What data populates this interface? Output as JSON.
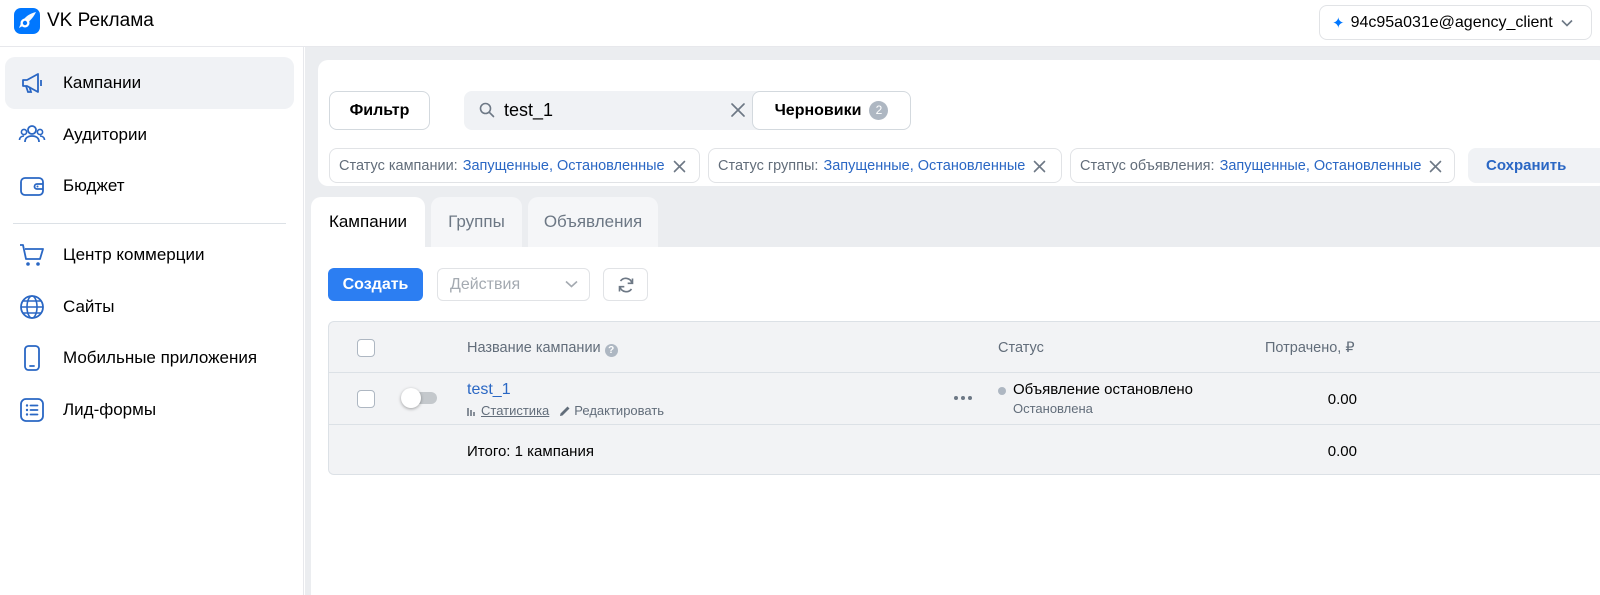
{
  "app": {
    "title": "VK Реклама",
    "account": "94c95a031e@agency_client",
    "brand_color": "#0077ff",
    "link_color": "#2a67c4"
  },
  "sidebar": {
    "items": [
      {
        "label": "Кампании",
        "icon": "megaphone-icon",
        "active": true
      },
      {
        "label": "Аудитории",
        "icon": "users-icon",
        "active": false
      },
      {
        "label": "Бюджет",
        "icon": "wallet-icon",
        "active": false
      },
      {
        "label": "Центр коммерции",
        "icon": "cart-icon",
        "active": false
      },
      {
        "label": "Сайты",
        "icon": "globe-icon",
        "active": false
      },
      {
        "label": "Мобильные приложения",
        "icon": "phone-icon",
        "active": false
      },
      {
        "label": "Лид-формы",
        "icon": "list-form-icon",
        "active": false
      }
    ]
  },
  "filters": {
    "filter_label": "Фильтр",
    "search_value": "test_1",
    "drafts_label": "Черновики",
    "drafts_count": "2",
    "chips": [
      {
        "key": "Статус кампании:",
        "value": "Запущенные, Остановленные"
      },
      {
        "key": "Статус группы:",
        "value": "Запущенные, Остановленные"
      },
      {
        "key": "Статус объявления:",
        "value": "Запущенные, Остановленные"
      }
    ],
    "save_label": "Сохранить"
  },
  "tabs": [
    {
      "label": "Кампании",
      "active": true
    },
    {
      "label": "Группы",
      "active": false
    },
    {
      "label": "Объявления",
      "active": false
    }
  ],
  "toolbar": {
    "create_label": "Создать",
    "actions_placeholder": "Действия"
  },
  "table": {
    "columns": {
      "name": "Название кампании",
      "status": "Статус",
      "spent": "Потрачено, ₽"
    },
    "rows": [
      {
        "name": "test_1",
        "stats_link": "Статистика",
        "edit_link": "Редактировать",
        "status": "Объявление остановлено",
        "status_sub": "Остановлена",
        "spent": "0.00",
        "enabled": false
      }
    ],
    "total_label": "Итого: 1 кампания",
    "total_spent": "0.00"
  }
}
